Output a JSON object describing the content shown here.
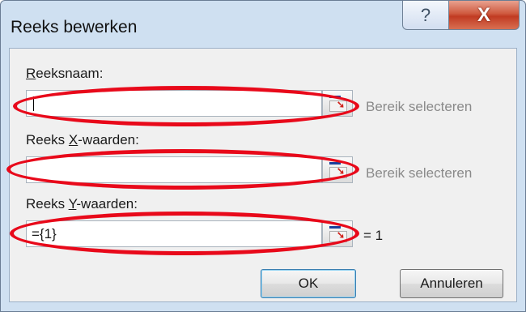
{
  "window": {
    "title": "Reeks bewerken",
    "help_glyph": "?",
    "close_glyph": "X"
  },
  "series_name": {
    "label": "Reeksnaam:",
    "value": "",
    "range_hint": "Bereik selecteren"
  },
  "x_values": {
    "label": "Reeks X-waarden:",
    "value": "",
    "range_hint": "Bereik selecteren"
  },
  "y_values": {
    "label": "Reeks Y-waarden:",
    "value": "={1}",
    "result": "= 1"
  },
  "buttons": {
    "ok": "OK",
    "cancel": "Annuleren"
  },
  "icons": {
    "help": "help-icon",
    "close": "close-icon",
    "range_picker": "range-picker-icon"
  },
  "colors": {
    "annotation_ellipse": "#e8091a",
    "close_button": "#c13b22"
  }
}
